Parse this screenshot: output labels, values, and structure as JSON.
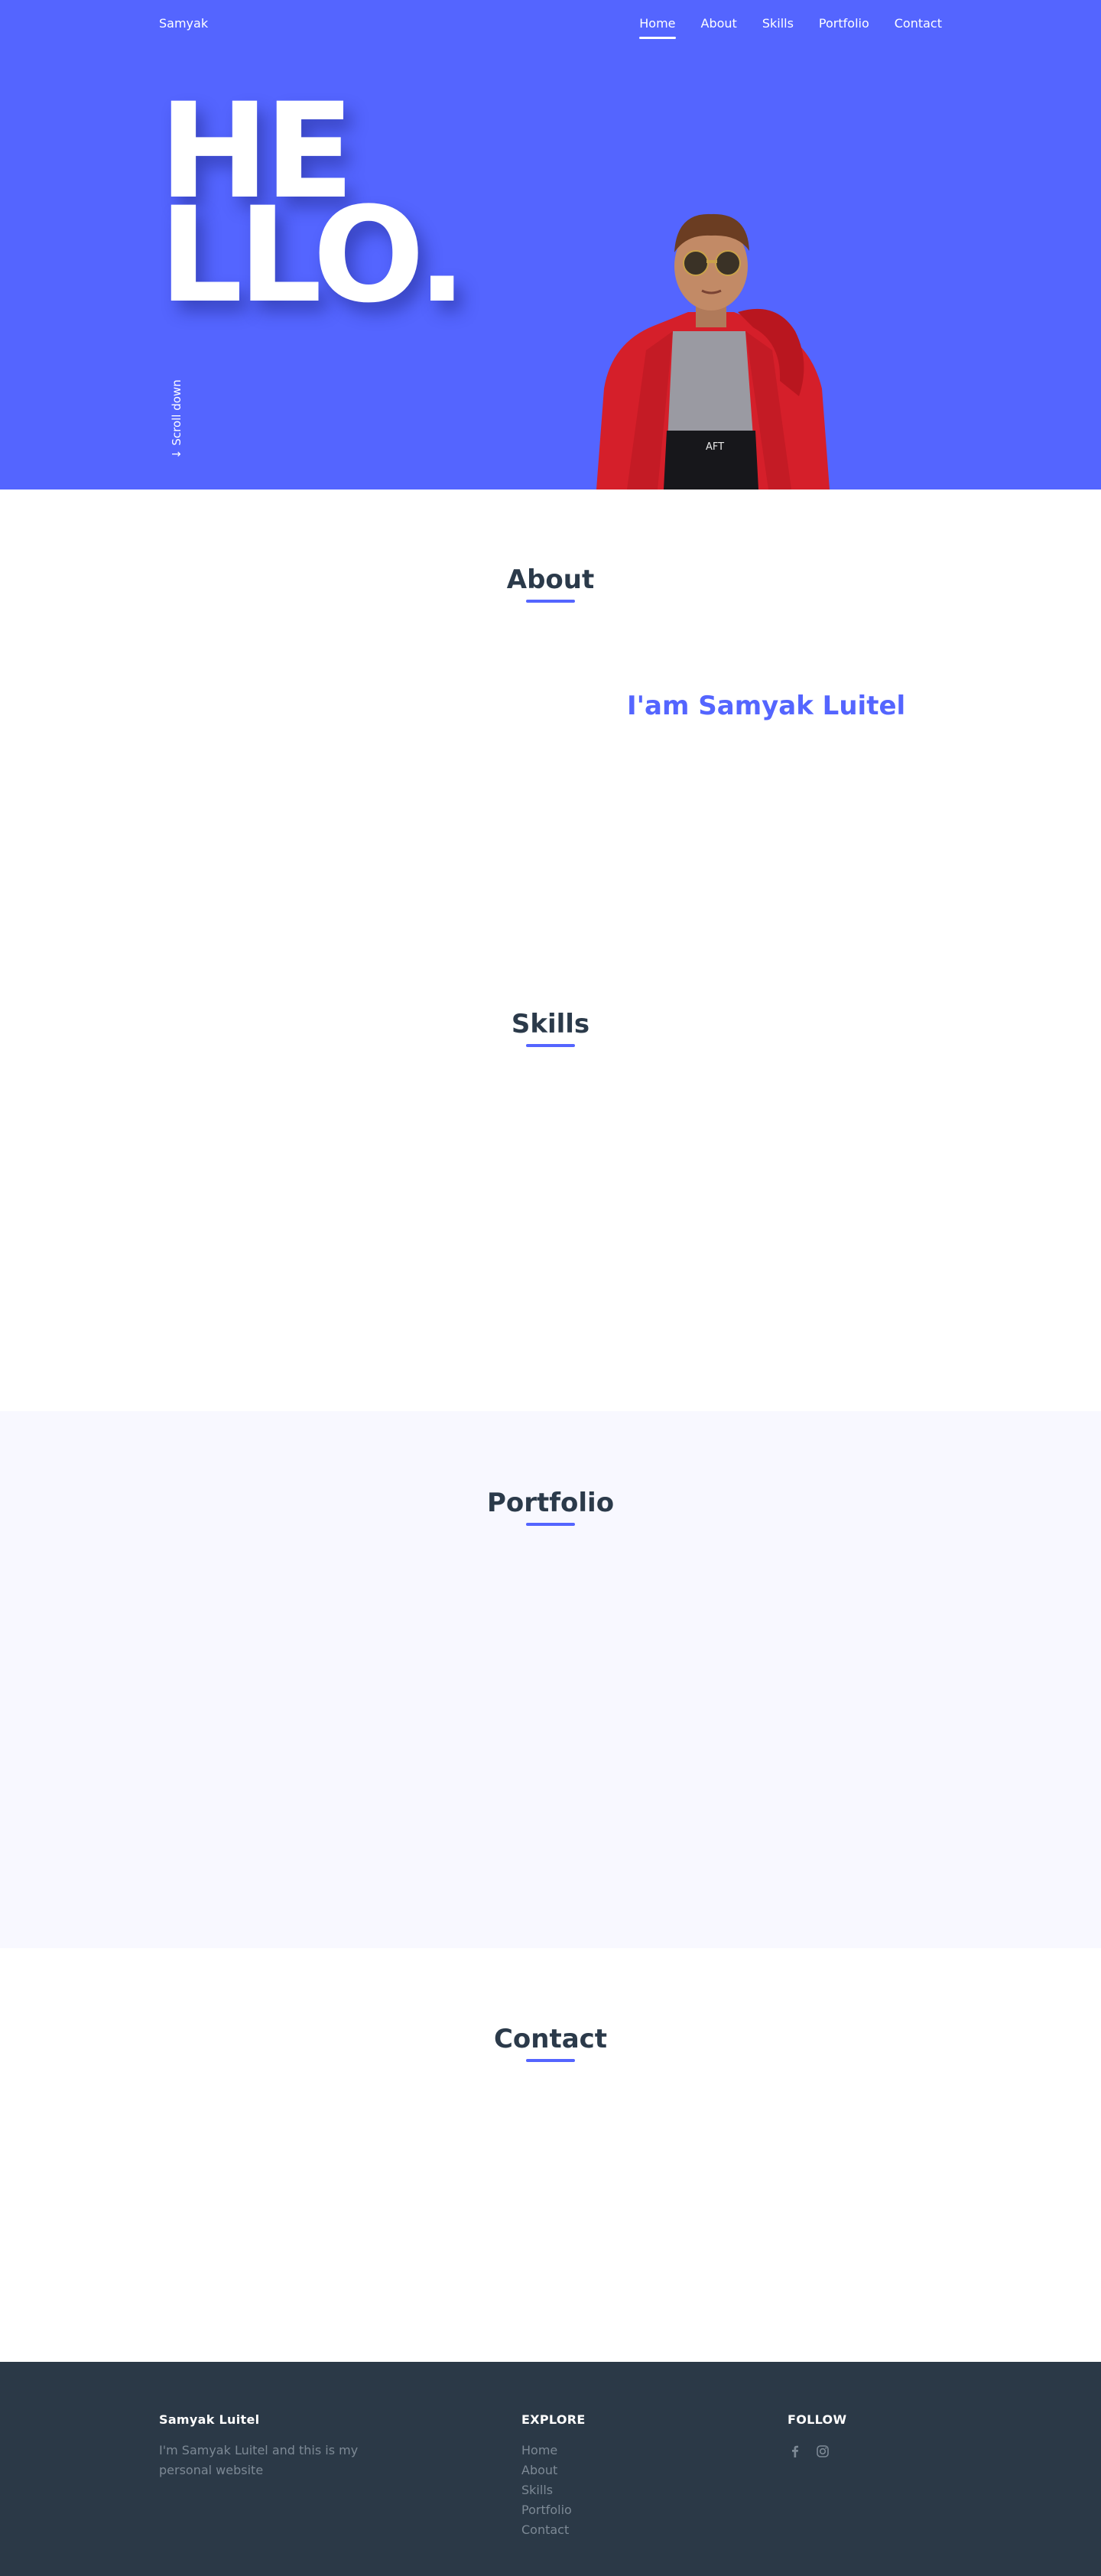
{
  "nav": {
    "brand": "Samyak",
    "links": [
      {
        "label": "Home",
        "active": true
      },
      {
        "label": "About",
        "active": false
      },
      {
        "label": "Skills",
        "active": false
      },
      {
        "label": "Portfolio",
        "active": false
      },
      {
        "label": "Contact",
        "active": false
      }
    ]
  },
  "hero": {
    "title_line1": "HE",
    "title_line2": "LLO.",
    "scroll_label": "↓ Scroll down",
    "background": "#5465ff"
  },
  "about": {
    "title": "About",
    "name_heading": "I'am Samyak Luitel"
  },
  "skills": {
    "title": "Skills"
  },
  "portfolio": {
    "title": "Portfolio"
  },
  "contact": {
    "title": "Contact"
  },
  "footer": {
    "col1": {
      "heading": "Samyak Luitel",
      "text": "I'm Samyak Luitel and this is my personal website"
    },
    "col2": {
      "heading": "EXPLORE",
      "links": [
        "Home",
        "About",
        "Skills",
        "Portfolio",
        "Contact"
      ]
    },
    "col3": {
      "heading": "FOLLOW",
      "icons": [
        "facebook-icon",
        "instagram-icon"
      ]
    },
    "background": "#2b3947"
  },
  "colors": {
    "accent": "#5465ff",
    "heading": "#2b3a4a",
    "muted": "#7d8995",
    "portfolio_bg": "#f8f8ff"
  }
}
